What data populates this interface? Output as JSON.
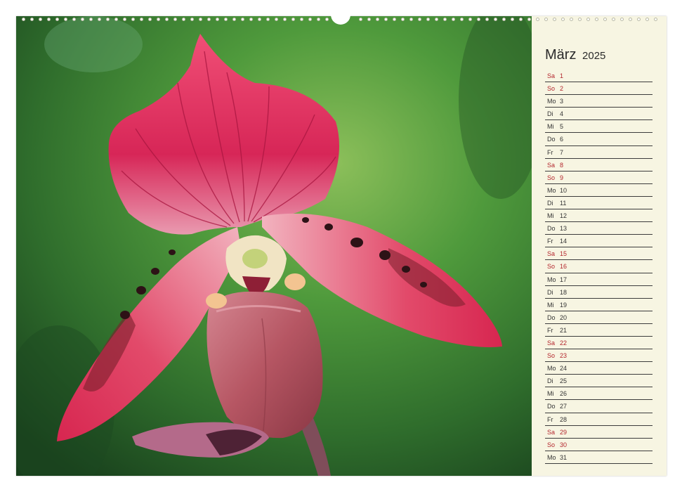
{
  "calendar": {
    "month": "März",
    "year": "2025",
    "weekend_color": "#b3262d",
    "days": [
      {
        "wd": "Sa",
        "d": "1",
        "weekend": true
      },
      {
        "wd": "So",
        "d": "2",
        "weekend": true
      },
      {
        "wd": "Mo",
        "d": "3",
        "weekend": false
      },
      {
        "wd": "Di",
        "d": "4",
        "weekend": false
      },
      {
        "wd": "Mi",
        "d": "5",
        "weekend": false
      },
      {
        "wd": "Do",
        "d": "6",
        "weekend": false
      },
      {
        "wd": "Fr",
        "d": "7",
        "weekend": false
      },
      {
        "wd": "Sa",
        "d": "8",
        "weekend": true
      },
      {
        "wd": "So",
        "d": "9",
        "weekend": true
      },
      {
        "wd": "Mo",
        "d": "10",
        "weekend": false
      },
      {
        "wd": "Di",
        "d": "11",
        "weekend": false
      },
      {
        "wd": "Mi",
        "d": "12",
        "weekend": false
      },
      {
        "wd": "Do",
        "d": "13",
        "weekend": false
      },
      {
        "wd": "Fr",
        "d": "14",
        "weekend": false
      },
      {
        "wd": "Sa",
        "d": "15",
        "weekend": true
      },
      {
        "wd": "So",
        "d": "16",
        "weekend": true
      },
      {
        "wd": "Mo",
        "d": "17",
        "weekend": false
      },
      {
        "wd": "Di",
        "d": "18",
        "weekend": false
      },
      {
        "wd": "Mi",
        "d": "19",
        "weekend": false
      },
      {
        "wd": "Do",
        "d": "20",
        "weekend": false
      },
      {
        "wd": "Fr",
        "d": "21",
        "weekend": false
      },
      {
        "wd": "Sa",
        "d": "22",
        "weekend": true
      },
      {
        "wd": "So",
        "d": "23",
        "weekend": true
      },
      {
        "wd": "Mo",
        "d": "24",
        "weekend": false
      },
      {
        "wd": "Di",
        "d": "25",
        "weekend": false
      },
      {
        "wd": "Mi",
        "d": "26",
        "weekend": false
      },
      {
        "wd": "Do",
        "d": "27",
        "weekend": false
      },
      {
        "wd": "Fr",
        "d": "28",
        "weekend": false
      },
      {
        "wd": "Sa",
        "d": "29",
        "weekend": true
      },
      {
        "wd": "So",
        "d": "30",
        "weekend": true
      },
      {
        "wd": "Mo",
        "d": "31",
        "weekend": false
      }
    ]
  },
  "photo": {
    "subject": "orchid-flower-photo",
    "colors": {
      "background": "#3f7a32",
      "petal": "#e03a63",
      "pouch": "#b5525f"
    }
  }
}
